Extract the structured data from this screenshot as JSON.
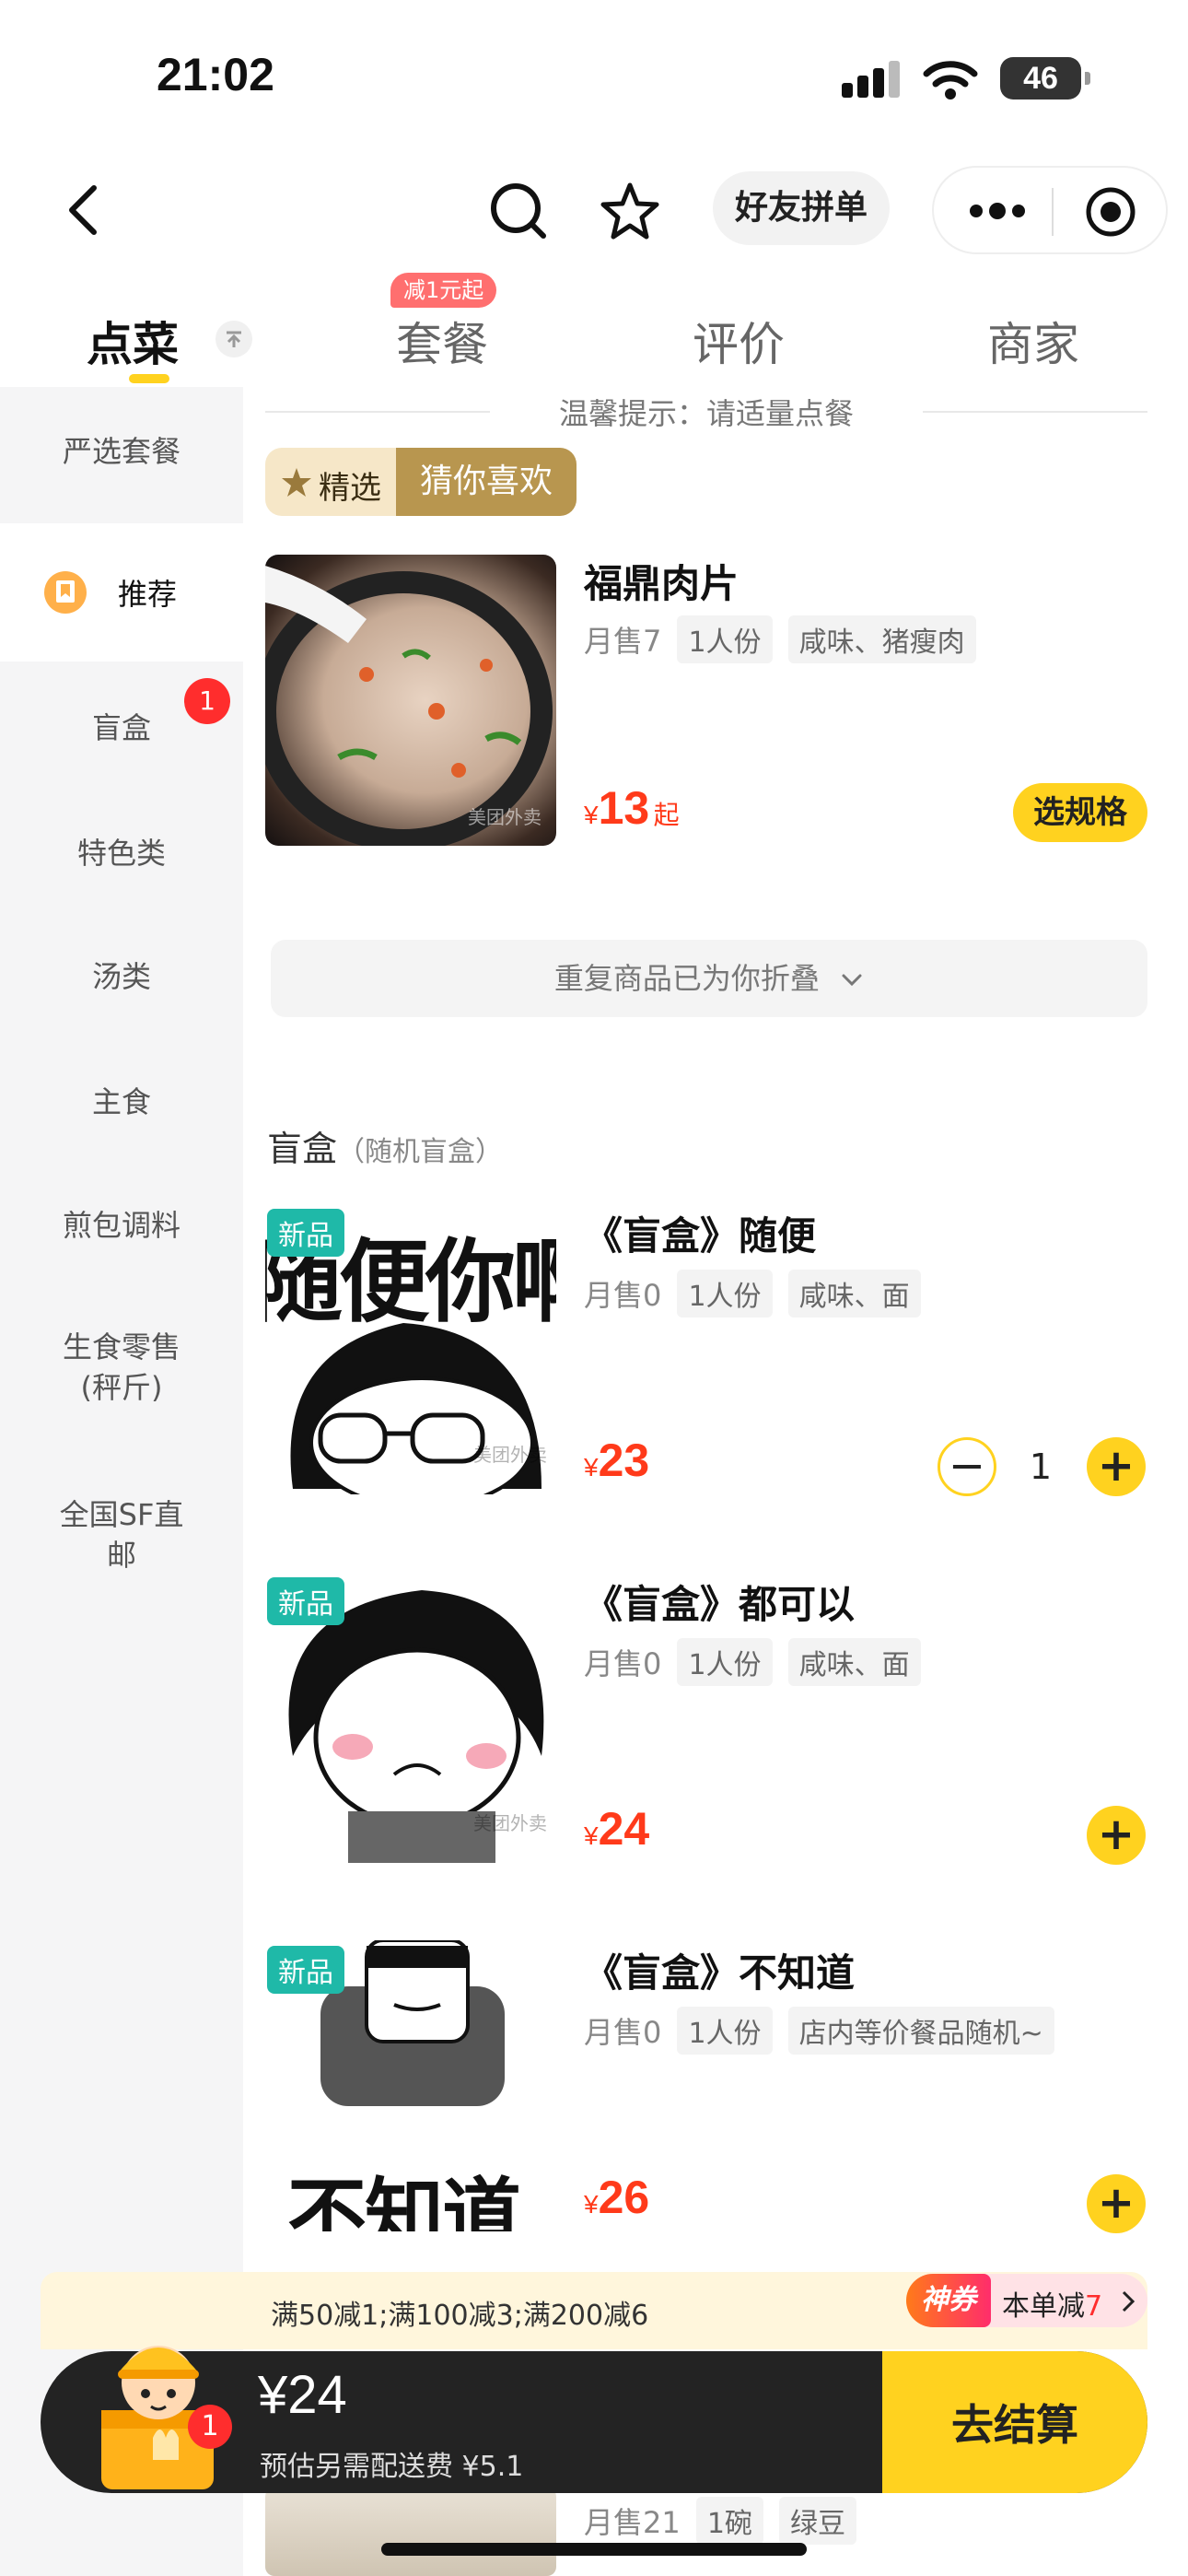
{
  "status_bar": {
    "time": "21:02",
    "battery": "46"
  },
  "nav": {
    "group_order_label": "好友拼单"
  },
  "tabs": [
    {
      "label": "点菜",
      "active": true
    },
    {
      "label": "套餐",
      "badge": "减1元起"
    },
    {
      "label": "评价"
    },
    {
      "label": "商家"
    }
  ],
  "sidebar": {
    "items": [
      {
        "label": "严选套餐"
      },
      {
        "label": "推荐",
        "active": true
      },
      {
        "label": "盲盒",
        "badge": "1"
      },
      {
        "label": "特色类"
      },
      {
        "label": "汤类"
      },
      {
        "label": "主食"
      },
      {
        "label": "煎包调料"
      },
      {
        "label": "生食零售",
        "label2": "(秤斤)"
      },
      {
        "label": "全国SF直",
        "label2": "邮"
      }
    ]
  },
  "notice": "温馨提示：请适量点餐",
  "chips": {
    "featured": "精选",
    "guess": "猜你喜欢"
  },
  "featured_item": {
    "name": "福鼎肉片",
    "sold": "月售7",
    "tags": [
      "1人份",
      "咸味、猪瘦肉"
    ],
    "price_symbol": "¥",
    "price": "13",
    "price_suffix": "起",
    "action": "选规格"
  },
  "collapse_notice": "重复商品已为你折叠",
  "section": {
    "title": "盲盒",
    "subtitle": "（随机盲盒）"
  },
  "items": [
    {
      "badge": "新品",
      "image_text": "随便你啊",
      "name": "《盲盒》随便",
      "sold": "月售0",
      "tags": [
        "1人份",
        "咸味、面"
      ],
      "price_symbol": "¥",
      "price": "23",
      "quantity": "1"
    },
    {
      "badge": "新品",
      "name": "《盲盒》都可以",
      "sold": "月售0",
      "tags": [
        "1人份",
        "咸味、面"
      ],
      "price_symbol": "¥",
      "price": "24"
    },
    {
      "badge": "新品",
      "image_text": "不知道",
      "name": "《盲盒》不知道",
      "sold": "月售0",
      "tags": [
        "1人份",
        "店内等价餐品随机~"
      ],
      "price_symbol": "¥",
      "price": "26"
    }
  ],
  "peek_item": {
    "sold": "月售21",
    "tags": [
      "1碗",
      "绿豆"
    ]
  },
  "promo": {
    "text": "满50减1;满100减3;满200减6",
    "badge": "神券",
    "discount_prefix": "本单减",
    "discount_value": "7"
  },
  "cart": {
    "count": "1",
    "total": "¥24",
    "delivery_note": "预估另需配送费 ¥5.1",
    "checkout": "去结算"
  },
  "watermark": "美团外卖",
  "colors": {
    "accent": "#ffd21f",
    "price": "#ff3a1a",
    "new_badge": "#1fb9a8",
    "cart_bar": "#222222"
  }
}
